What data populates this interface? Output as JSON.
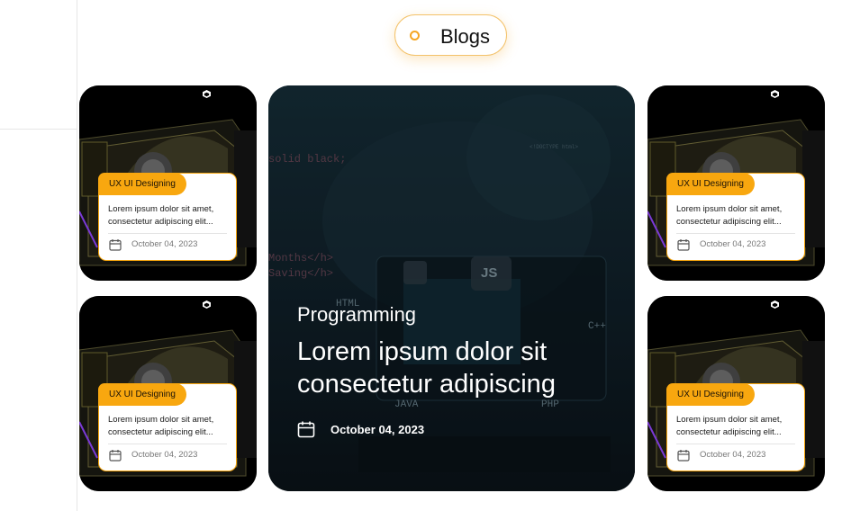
{
  "section": {
    "title": "Blogs"
  },
  "featured": {
    "category": "Programming",
    "title": "Lorem ipsum dolor sit consectetur adipiscing",
    "date": "October 04, 2023",
    "code_words": [
      "HTML",
      "JS",
      "C++",
      "JAVA",
      "PHP",
      "<!DOCTYPE html>",
      "solid black;",
      "Saving</h>",
      "Months</h>"
    ]
  },
  "cards": [
    {
      "tag": "UX UI Designing",
      "description": "Lorem ipsum dolor sit amet, consectetur adipiscing elit...",
      "date": "October 04, 2023"
    },
    {
      "tag": "UX UI Designing",
      "description": "Lorem ipsum dolor sit amet, consectetur adipiscing elit...",
      "date": "October 04, 2023"
    },
    {
      "tag": "UX UI Designing",
      "description": "Lorem ipsum dolor sit amet, consectetur adipiscing elit...",
      "date": "October 04, 2023"
    },
    {
      "tag": "UX UI Designing",
      "description": "Lorem ipsum dolor sit amet, consectetur adipiscing elit...",
      "date": "October 04, 2023"
    }
  ],
  "colors": {
    "accent": "#f8a70f",
    "card_bg": "#000000",
    "feature_overlay": "#13242f"
  },
  "icons": [
    "calendar-icon",
    "cube-icon",
    "status-dot-icon"
  ]
}
